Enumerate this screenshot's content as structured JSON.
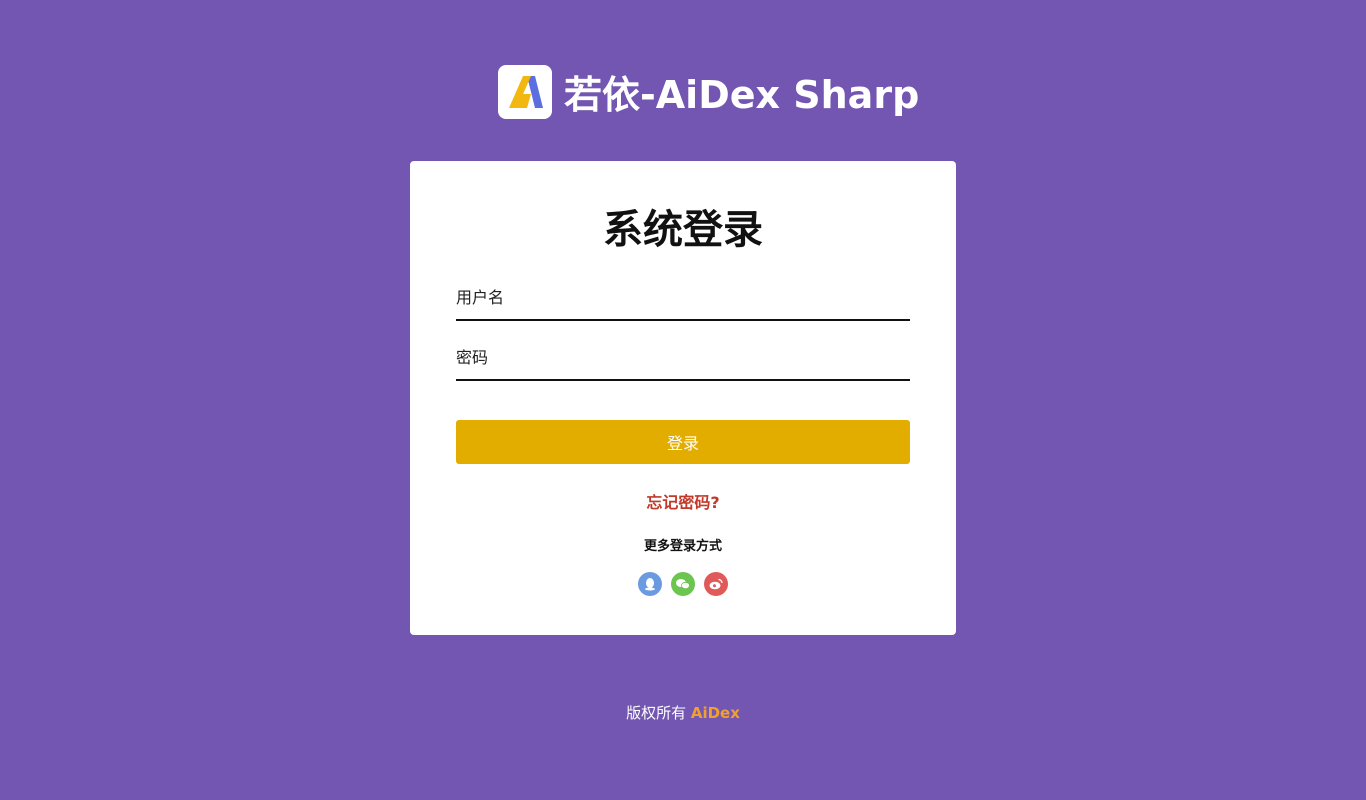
{
  "header": {
    "title": "若依-AiDex Sharp"
  },
  "login": {
    "title": "系统登录",
    "username_placeholder": "用户名",
    "password_placeholder": "密码",
    "submit_label": "登录",
    "forgot_label": "忘记密码?",
    "more_label": "更多登录方式",
    "socials": [
      {
        "name": "qq-icon",
        "color": "#6a9be0"
      },
      {
        "name": "wechat-icon",
        "color": "#6cc54f"
      },
      {
        "name": "weibo-icon",
        "color": "#e05a5a"
      }
    ]
  },
  "footer": {
    "copyright_label": "版权所有",
    "brand": "AiDex"
  },
  "colors": {
    "background": "#7356b2",
    "accent": "#e3ad00",
    "forgot": "#c0392b",
    "footer_brand": "#f0a030"
  }
}
